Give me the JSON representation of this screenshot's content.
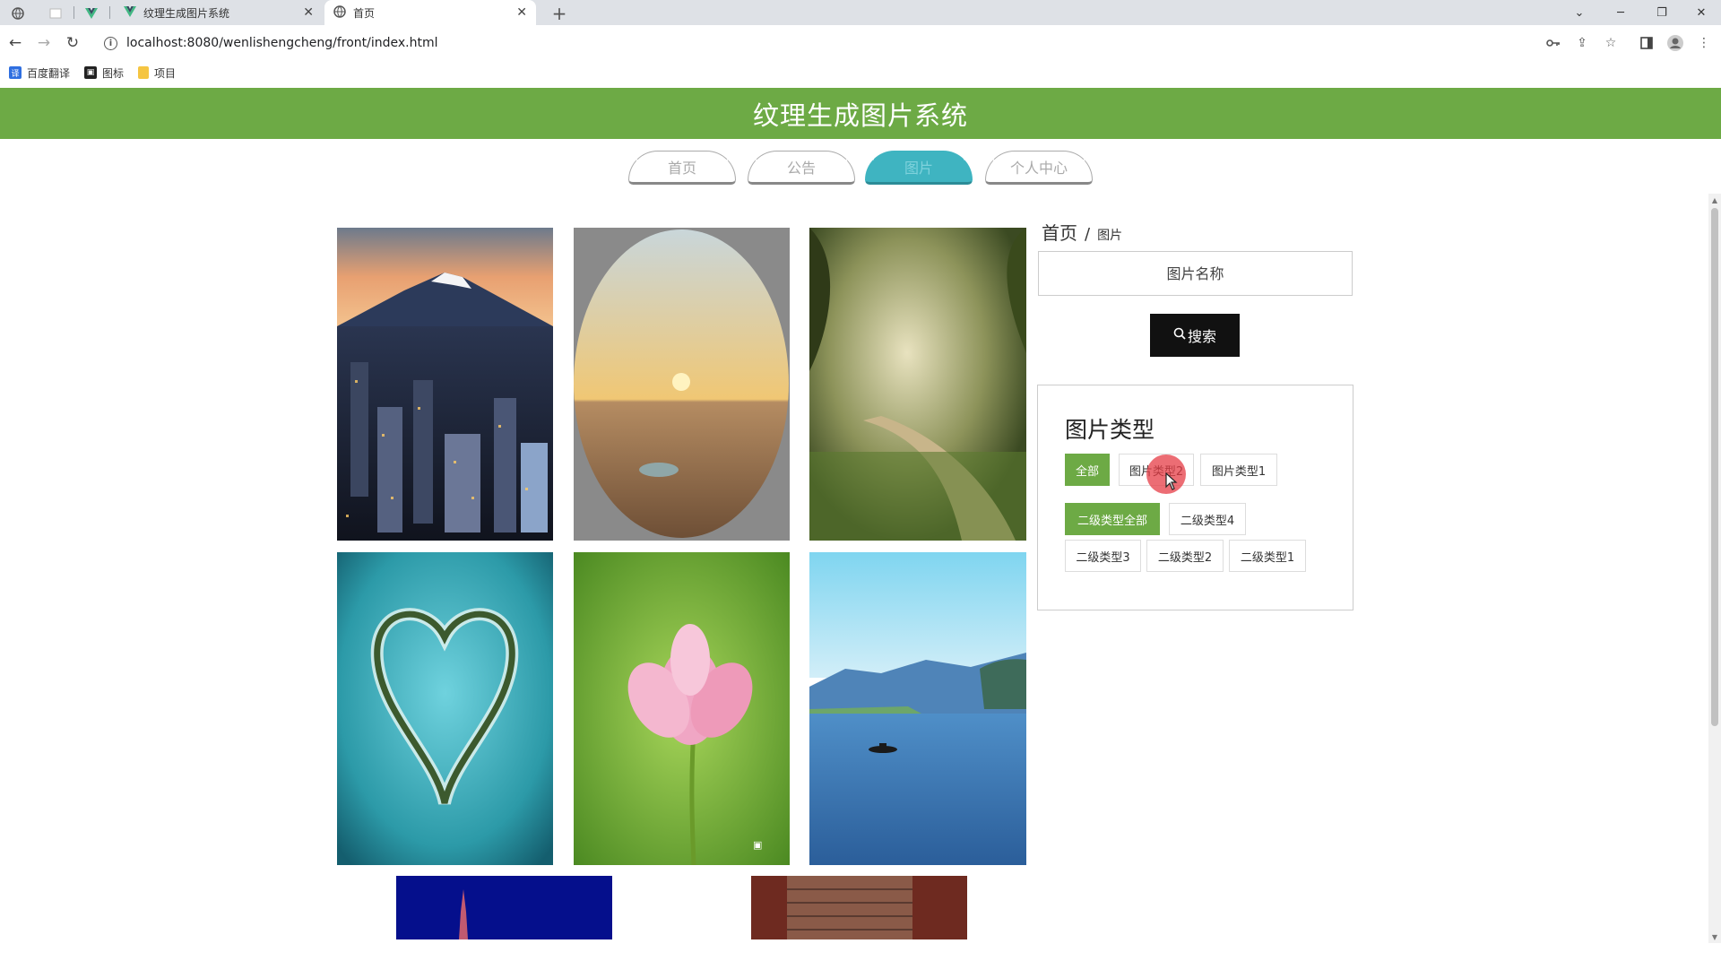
{
  "browser": {
    "tabs": [
      {
        "label": "纹理生成图片系统",
        "icon": "vue-logo-icon",
        "active": false
      },
      {
        "label": "首页",
        "icon": "globe-icon",
        "active": true
      }
    ],
    "new_tab": "+",
    "url": "localhost:8080/wenlishengcheng/front/index.html",
    "bookmarks": [
      {
        "label": "百度翻译",
        "icon": "baidu-translate-icon",
        "color": "#2f6fe0"
      },
      {
        "label": "图标",
        "icon": "image-icon",
        "color": "#222222"
      },
      {
        "label": "项目",
        "icon": "folder-icon",
        "color": "#f5c542"
      }
    ]
  },
  "site": {
    "title": "纹理生成图片系统",
    "nav": [
      {
        "label": "首页",
        "active": false
      },
      {
        "label": "公告",
        "active": false
      },
      {
        "label": "图片",
        "active": true
      },
      {
        "label": "个人中心",
        "active": false
      }
    ],
    "breadcrumb": {
      "home": "首页",
      "separator": "/",
      "current": "图片"
    },
    "search": {
      "placeholder": "图片名称",
      "button_label": "搜索"
    },
    "types": {
      "title": "图片类型",
      "primary": [
        {
          "label": "全部",
          "active": true
        },
        {
          "label": "图片类型2",
          "active": false
        },
        {
          "label": "图片类型1",
          "active": false
        }
      ],
      "secondary": [
        {
          "label": "二级类型全部",
          "active": true
        },
        {
          "label": "二级类型4",
          "active": false
        },
        {
          "label": "二级类型3",
          "active": false
        },
        {
          "label": "二级类型2",
          "active": false
        },
        {
          "label": "二级类型1",
          "active": false
        }
      ]
    },
    "gallery": [
      {
        "subject": "mountain-city"
      },
      {
        "subject": "desert-sunset"
      },
      {
        "subject": "forest-path"
      },
      {
        "subject": "heart-island"
      },
      {
        "subject": "lotus-flower"
      },
      {
        "subject": "lake-boat"
      },
      {
        "subject": "night-tower"
      },
      {
        "subject": "red-architecture"
      }
    ]
  },
  "colors": {
    "brand": "#6daa45",
    "nav_active": "#3fb4c1",
    "search_button": "#111111"
  }
}
